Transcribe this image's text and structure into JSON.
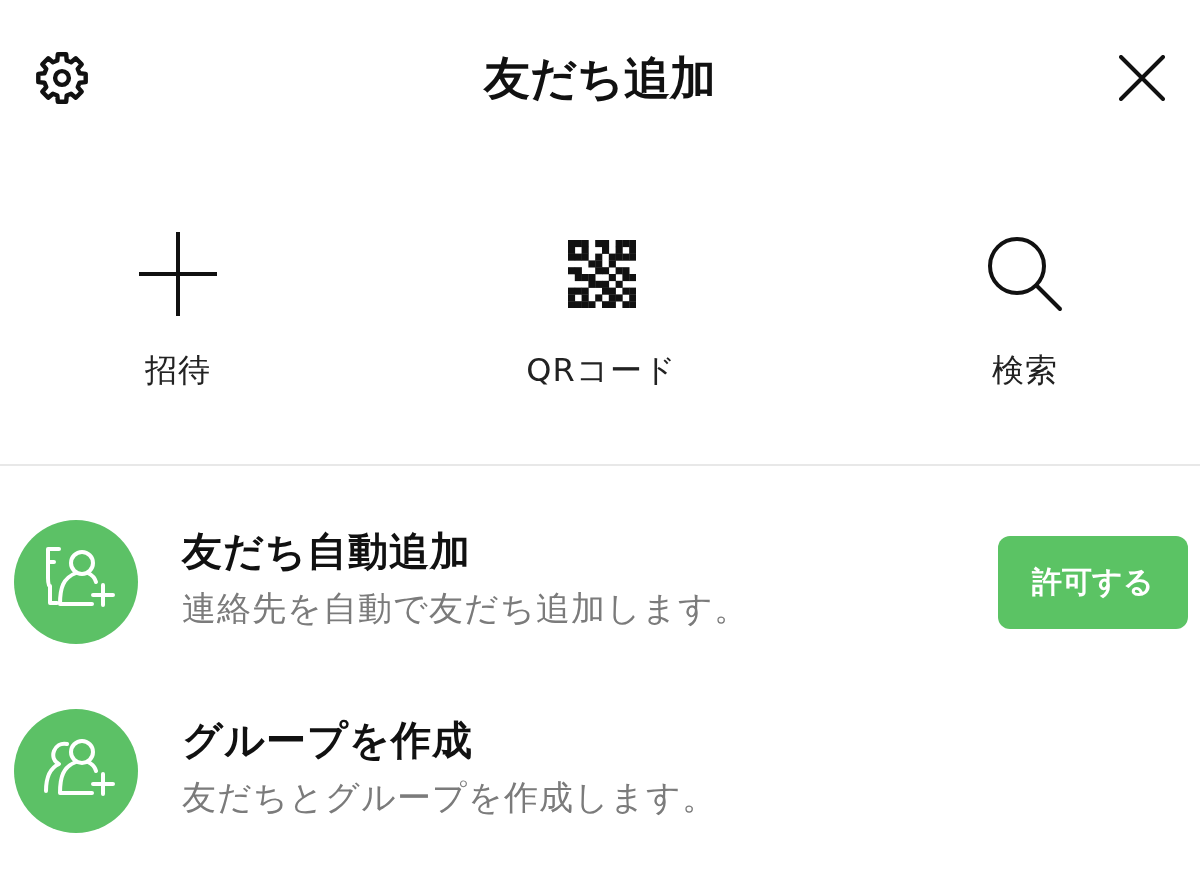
{
  "header": {
    "title": "友だち追加"
  },
  "actions": [
    {
      "kind": "invite",
      "label": "招待"
    },
    {
      "kind": "qr",
      "label": "QRコード"
    },
    {
      "kind": "search",
      "label": "検索"
    }
  ],
  "items": [
    {
      "kind": "auto-add",
      "title": "友だち自動追加",
      "subtitle": "連絡先を自動で友だち追加します。",
      "button": "許可する"
    },
    {
      "kind": "group",
      "title": "グループを作成",
      "subtitle": "友だちとグループを作成します。"
    }
  ]
}
